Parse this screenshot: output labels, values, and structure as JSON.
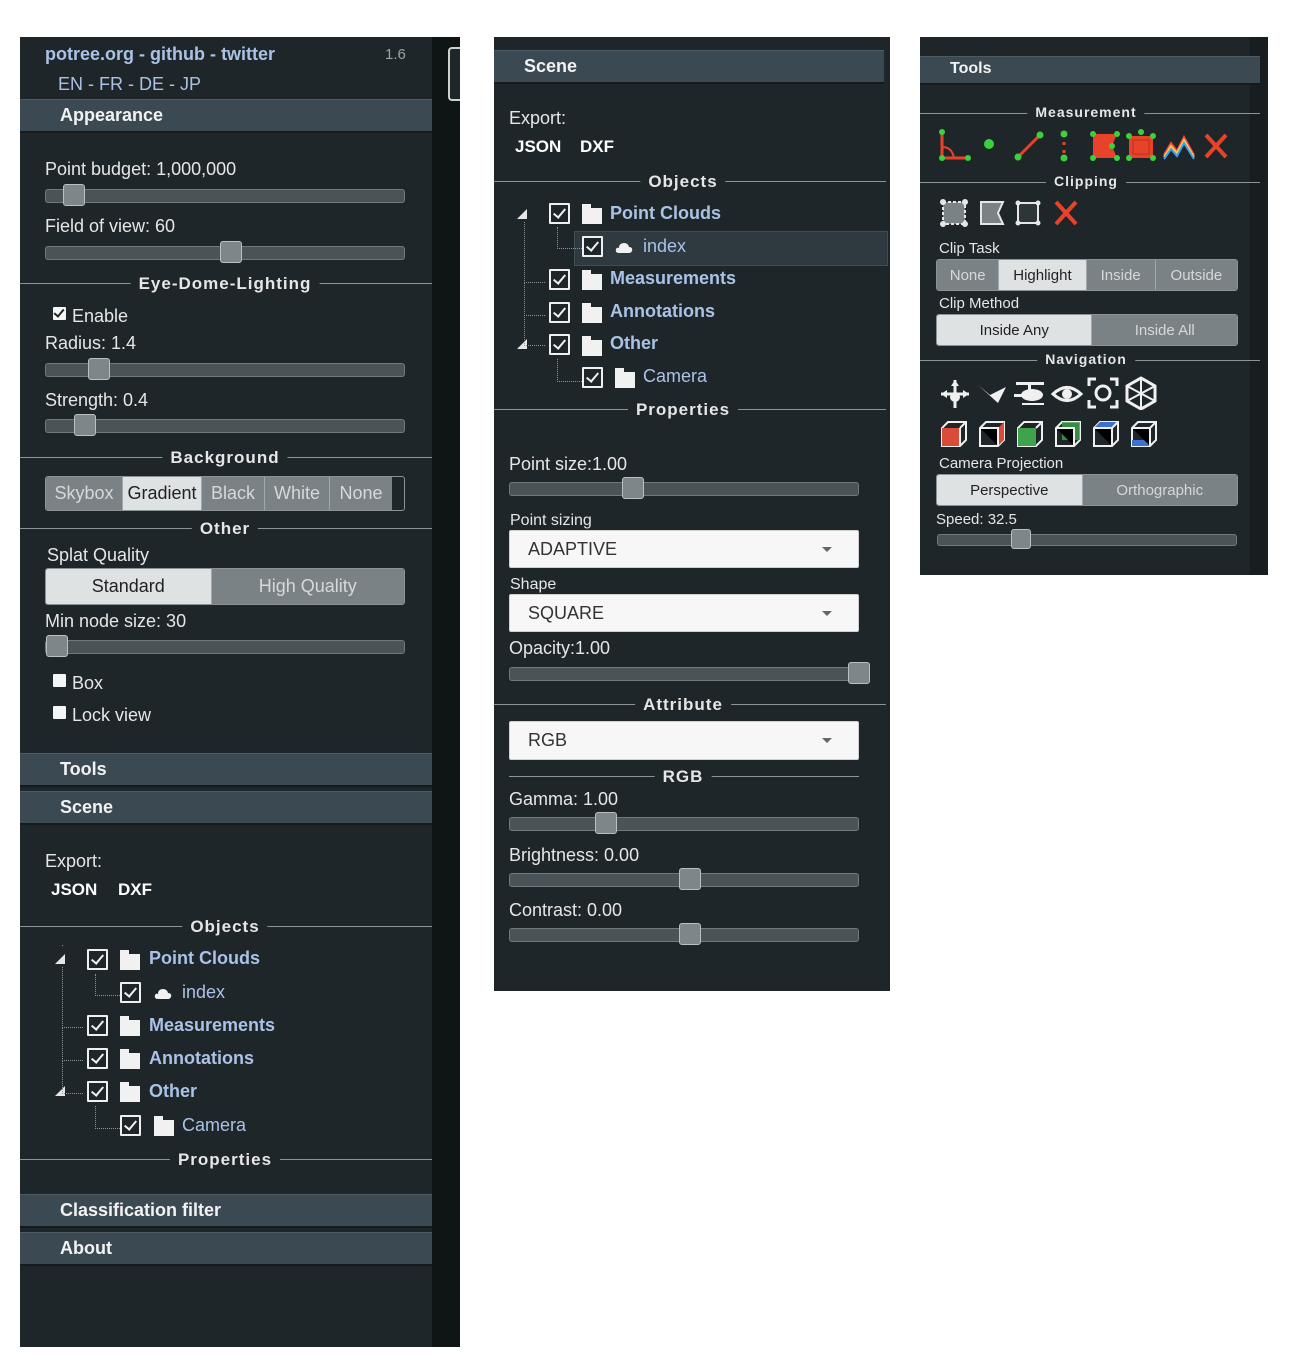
{
  "left": {
    "links": [
      "potree.org",
      "github",
      "twitter"
    ],
    "sep": "-",
    "version": "1.6",
    "languages": "EN - FR - DE - JP",
    "appearance": {
      "title": "Appearance",
      "point_budget": "Point budget: 1,000,000",
      "fov": "Field of view: 60",
      "edl_title": "Eye-Dome-Lighting",
      "edl_enable": "Enable",
      "radius": "Radius: 1.4",
      "strength": "Strength: 0.4",
      "bg_title": "Background",
      "bg_options": [
        "Skybox",
        "Gradient",
        "Black",
        "White",
        "None"
      ],
      "bg_selected": "Gradient",
      "other_title": "Other",
      "splat_label": "Splat Quality",
      "splat_options": [
        "Standard",
        "High Quality"
      ],
      "min_node": "Min node size: 30",
      "box": "Box",
      "lock_view": "Lock view"
    },
    "tools_title": "Tools",
    "scene": {
      "title": "Scene",
      "export_label": "Export:",
      "export_json": "JSON",
      "export_dxf": "DXF",
      "objects_title": "Objects",
      "tree": [
        "Point Clouds",
        "index",
        "Measurements",
        "Annotations",
        "Other",
        "Camera"
      ],
      "properties_title": "Properties"
    },
    "classification_title": "Classification filter",
    "about_title": "About"
  },
  "middle": {
    "scene_title": "Scene",
    "export_label": "Export:",
    "export_json": "JSON",
    "export_dxf": "DXF",
    "objects_title": "Objects",
    "tree": [
      "Point Clouds",
      "index",
      "Measurements",
      "Annotations",
      "Other",
      "Camera"
    ],
    "properties_title": "Properties",
    "point_size": "Point size:1.00",
    "point_sizing_label": "Point sizing",
    "point_sizing_value": "ADAPTIVE",
    "shape_label": "Shape",
    "shape_value": "SQUARE",
    "opacity": "Opacity:1.00",
    "attribute_title": "Attribute",
    "attribute_value": "RGB",
    "rgb_title": "RGB",
    "gamma": "Gamma: 1.00",
    "brightness": "Brightness: 0.00",
    "contrast": "Contrast: 0.00"
  },
  "right": {
    "tools_title": "Tools",
    "measurement_title": "Measurement",
    "clipping_title": "Clipping",
    "clip_task_label": "Clip Task",
    "clip_task_options": [
      "None",
      "Highlight",
      "Inside",
      "Outside"
    ],
    "clip_task_selected": "Highlight",
    "clip_method_label": "Clip Method",
    "clip_method_options": [
      "Inside Any",
      "Inside All"
    ],
    "navigation_title": "Navigation",
    "camera_projection_label": "Camera Projection",
    "projection_options": [
      "Perspective",
      "Orthographic"
    ],
    "speed": "Speed: 32.5"
  },
  "sliders": {
    "point_budget": 0.05,
    "fov": 0.5,
    "radius": 0.12,
    "strength": 0.08,
    "min_node": 0.0,
    "point_size": 0.33,
    "opacity": 1.0,
    "gamma": 0.25,
    "brightness": 0.5,
    "contrast": 0.5,
    "speed": 0.25
  },
  "colors": {
    "panel_bg": "#1f2629",
    "header_bg": "#3b4a52",
    "link_blue": "#a9c2e6",
    "danger_red": "#e8432a",
    "measure_green": "#3bd13b"
  },
  "icons": [
    "angle-icon",
    "point-icon",
    "distance-icon",
    "height-icon",
    "area-icon",
    "volume-icon",
    "profile-icon",
    "remove-measurements-icon",
    "clip-volume-icon",
    "clip-box-icon",
    "clip-polygon-icon",
    "remove-clipping-icon",
    "earth-controls-icon",
    "fly-controls-icon",
    "helicopter-controls-icon",
    "orbit-controls-icon",
    "focus-icon",
    "perspective-cube-icon",
    "left-view-icon",
    "right-view-icon",
    "front-view-icon",
    "back-view-icon",
    "top-view-icon",
    "bottom-view-icon",
    "point-cloud-icon",
    "folder-icon",
    "tree-expand-icon"
  ]
}
